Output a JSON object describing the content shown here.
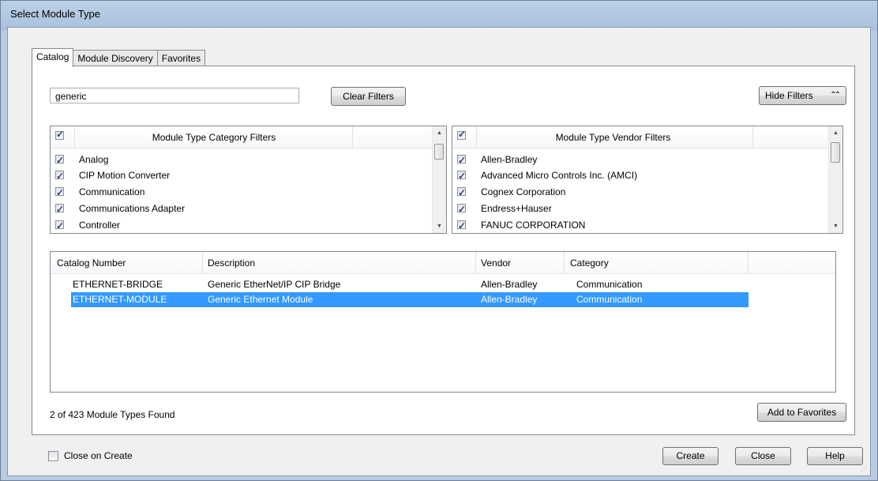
{
  "window": {
    "title": "Select Module Type"
  },
  "tabs": [
    {
      "label": "Catalog",
      "active": true
    },
    {
      "label": "Module Discovery",
      "active": false
    },
    {
      "label": "Favorites",
      "active": false
    }
  ],
  "search": {
    "value": "generic"
  },
  "buttons": {
    "clear_filters": "Clear Filters",
    "hide_filters": "Hide Filters",
    "hide_filters_icon": "⌃⌃",
    "add_to_favorites": "Add to Favorites",
    "create": "Create",
    "close": "Close",
    "help": "Help"
  },
  "category_filters": {
    "header": "Module Type Category Filters",
    "items": [
      {
        "label": "Analog",
        "checked": true
      },
      {
        "label": "CIP Motion Converter",
        "checked": true
      },
      {
        "label": "Communication",
        "checked": true
      },
      {
        "label": "Communications Adapter",
        "checked": true
      },
      {
        "label": "Controller",
        "checked": true
      }
    ]
  },
  "vendor_filters": {
    "header": "Module Type Vendor Filters",
    "items": [
      {
        "label": "Allen-Bradley",
        "checked": true
      },
      {
        "label": "Advanced Micro Controls Inc. (AMCI)",
        "checked": true
      },
      {
        "label": "Cognex Corporation",
        "checked": true
      },
      {
        "label": "Endress+Hauser",
        "checked": true
      },
      {
        "label": "FANUC CORPORATION",
        "checked": true
      }
    ]
  },
  "results": {
    "columns": [
      "Catalog Number",
      "Description",
      "Vendor",
      "Category"
    ],
    "rows": [
      {
        "catalog": "ETHERNET-BRIDGE",
        "description": "Generic EtherNet/IP CIP Bridge",
        "vendor": "Allen-Bradley",
        "category": "Communication",
        "selected": false
      },
      {
        "catalog": "ETHERNET-MODULE",
        "description": "Generic Ethernet Module",
        "vendor": "Allen-Bradley",
        "category": "Communication",
        "selected": true
      }
    ]
  },
  "status": {
    "found_text": "2 of 423 Module Types Found"
  },
  "close_on_create": {
    "label": "Close on Create",
    "checked": false
  },
  "colors": {
    "selection": "#3399ff",
    "title_bar": "#b9cde6"
  }
}
